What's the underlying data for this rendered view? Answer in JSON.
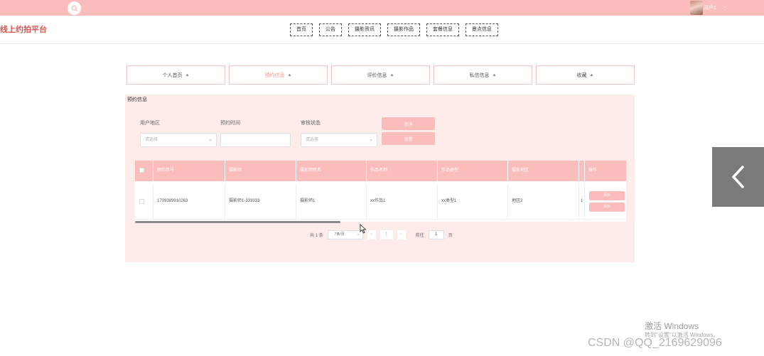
{
  "brand": {
    "title": "线上约拍平台"
  },
  "topbar": {
    "user_name": "用户1",
    "user_caret": "⌄"
  },
  "nav": {
    "items": [
      "首页",
      "公告",
      "摄影资讯",
      "摄影作品",
      "套餐信息",
      "景点信息"
    ]
  },
  "tabs": {
    "items": [
      {
        "label": "个人首页",
        "icon": "▲"
      },
      {
        "label": "预约信息",
        "icon": "▲"
      },
      {
        "label": "评价信息",
        "icon": "▲"
      },
      {
        "label": "私信信息",
        "icon": "▲"
      },
      {
        "label": "收藏",
        "icon": "▲"
      }
    ],
    "active": "预约信息"
  },
  "panel": {
    "title": "预约信息",
    "filters": {
      "region_label": "用户地区",
      "region_placeholder": "请选择",
      "time_label": "预约时间",
      "time_value": "",
      "status_label": "审核状态",
      "status_placeholder": "请选择"
    },
    "buttons": {
      "query": "查询",
      "reset": "重置"
    },
    "table": {
      "columns": [
        "",
        "预约单号",
        "摄影师",
        "摄影师姓名",
        "作品名称",
        "作品类型",
        "摄影地区",
        "",
        "操作"
      ],
      "rows": [
        {
          "order_no": "1709389910263",
          "photographer": "摄影师1-333333",
          "photographer_name": "摄影师1",
          "work_name": "xx作品1",
          "work_type": "xx类型1",
          "region": "地区2",
          "extra": "1",
          "actions": [
            "评价",
            "评价"
          ]
        }
      ]
    },
    "pager": {
      "total": "共 1 条",
      "page_size": "7条/页",
      "prev": "‹",
      "current": "1",
      "next": "›",
      "goto_label": "前往",
      "goto_value": "1",
      "page_suffix": "页"
    }
  },
  "overlay": {
    "watermark_title": "激活 Windows",
    "watermark_sub": "转到\"设置\"以激活 Windows。",
    "csdn": "CSDN @QQ_2169629096"
  },
  "colors": {
    "accent": "#fbbcbc",
    "panel_bg": "#fdecea",
    "brand": "#d9534f"
  },
  "icons": {
    "search": "search-icon",
    "back": "chevron-left-icon",
    "tab": "lock-icon"
  }
}
